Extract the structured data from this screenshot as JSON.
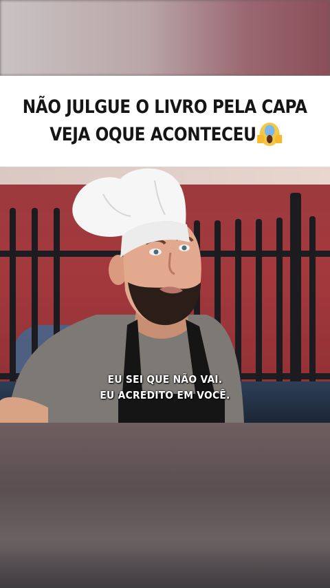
{
  "title": {
    "line1": "NÃO JULGUE O LIVRO PELA CAPA",
    "line2": "VEJA OQUE ACONTECEU",
    "emoji": "face-screaming-in-fear-icon"
  },
  "video": {
    "subtitle_line1": "EU SEI QUE NÃO VAI.",
    "subtitle_line2": "EU ACREDITO EM VOCÊ."
  },
  "colors": {
    "background_band": "#ffffff",
    "title_text": "#151515",
    "wall": "#a3393d",
    "fence": "#1c1c20",
    "chef_hat": "#f4f4f4",
    "apron": "#151515",
    "shirt": "#7d7a76"
  }
}
